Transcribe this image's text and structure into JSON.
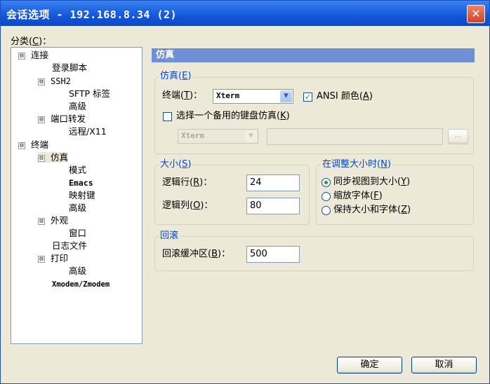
{
  "window": {
    "title": "会话选项 - 192.168.8.34 (2)",
    "close_glyph": "✕"
  },
  "category_label": {
    "text": "分类",
    "shortcut": "C",
    "suffix": "："
  },
  "tree": [
    {
      "label": "连接",
      "exp": "⊟"
    },
    {
      "label": "登录脚本"
    },
    {
      "label": "SSH2",
      "exp": "⊟"
    },
    {
      "label": "SFTP 标签"
    },
    {
      "label": "高级"
    },
    {
      "label": "端口转发",
      "exp": "⊟"
    },
    {
      "label": "远程/X11"
    },
    {
      "label": "终端",
      "exp": "⊟"
    },
    {
      "label": "仿真",
      "exp": "⊟"
    },
    {
      "label": "模式"
    },
    {
      "label": "Emacs"
    },
    {
      "label": "映射键"
    },
    {
      "label": "高级"
    },
    {
      "label": "外观",
      "exp": "⊟"
    },
    {
      "label": "窗口"
    },
    {
      "label": "日志文件"
    },
    {
      "label": "打印",
      "exp": "⊟"
    },
    {
      "label": "高级"
    },
    {
      "label": "Xmodem/Zmodem"
    }
  ],
  "panel_header": "仿真",
  "emulation": {
    "group_title": "仿真",
    "group_key": "E",
    "terminal_label": "终端",
    "terminal_key": "T",
    "terminal_colon": "：",
    "terminal_value": "Xterm",
    "ansi_label": "ANSI 颜色",
    "ansi_key": "A",
    "ansi_checked": true,
    "alt_kbd_label": "选择一个备用的键盘仿真",
    "alt_kbd_key": "K",
    "alt_kbd_checked": false,
    "alt_combo_value": "Xterm",
    "alt_text_value": "",
    "browse_label": "..."
  },
  "size": {
    "group_title": "大小",
    "group_key": "S",
    "rows_label": "逻辑行",
    "rows_key": "R",
    "rows_value": "24",
    "cols_label": "逻辑列",
    "cols_key": "O",
    "cols_value": "80",
    "colon": "："
  },
  "resize": {
    "group_title": "在调整大小时",
    "group_key": "N",
    "options": [
      {
        "label": "同步视图到大小",
        "key": "Y",
        "selected": true
      },
      {
        "label": "缩放字体",
        "key": "F",
        "selected": false
      },
      {
        "label": "保持大小和字体",
        "key": "Z",
        "selected": false
      }
    ]
  },
  "scrollback": {
    "group_title": "回滚",
    "buffer_label": "回滚缓冲区",
    "buffer_key": "B",
    "colon": "：",
    "buffer_value": "500"
  },
  "buttons": {
    "ok": "确定",
    "cancel": "取消"
  },
  "colors": {
    "titlebar": "#1f63e2",
    "header": "#6f8fd7",
    "group_title": "#0046d5",
    "dialog_bg": "#ece9d8"
  }
}
